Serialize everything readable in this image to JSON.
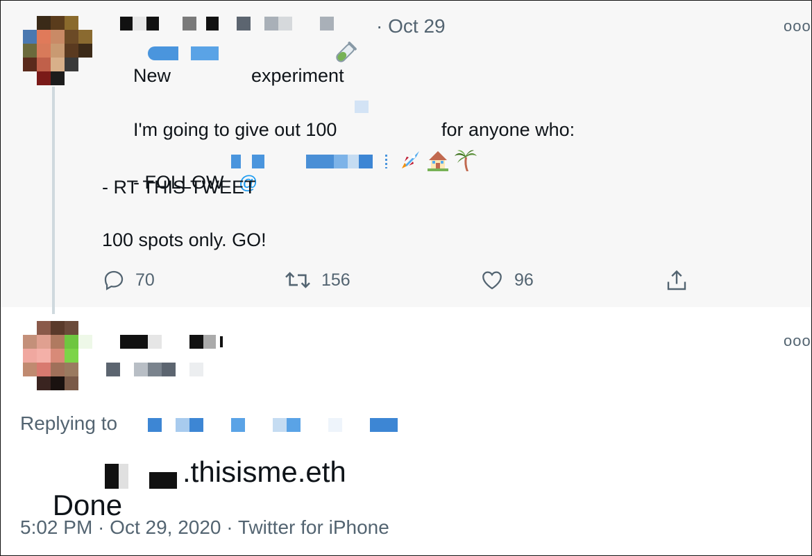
{
  "tweet": {
    "date": "· Oct 29",
    "more_glyph": "ooo",
    "line1_before": "New",
    "line1_after": "experiment",
    "line1_emoji_icon": "test-tube-icon",
    "line2_before": "I'm going to give out 100",
    "line2_after": "for anyone who:",
    "line3_prefix": "- FOLLOW",
    "line3_at": "@",
    "line3_emoji_icons": [
      "rocket-icon",
      "house-icon",
      "palm-tree-icon"
    ],
    "line4": "- RT THIS TWEET",
    "line5": "100 spots only. GO!",
    "actions": {
      "replies": "70",
      "retweets": "156",
      "likes": "96"
    }
  },
  "reply": {
    "more_glyph": "ooo",
    "replying_to": "Replying to",
    "text_before": "Done",
    "text_after": ".thisisme.eth",
    "time": "5:02 PM",
    "sep1": " · ",
    "date": "Oct 29, 2020",
    "sep2": " · ",
    "source": "Twitter for iPhone"
  },
  "colors": {
    "link_blue": "#1d9bf0",
    "muted": "#536471",
    "thread_line": "#cfd9de"
  }
}
